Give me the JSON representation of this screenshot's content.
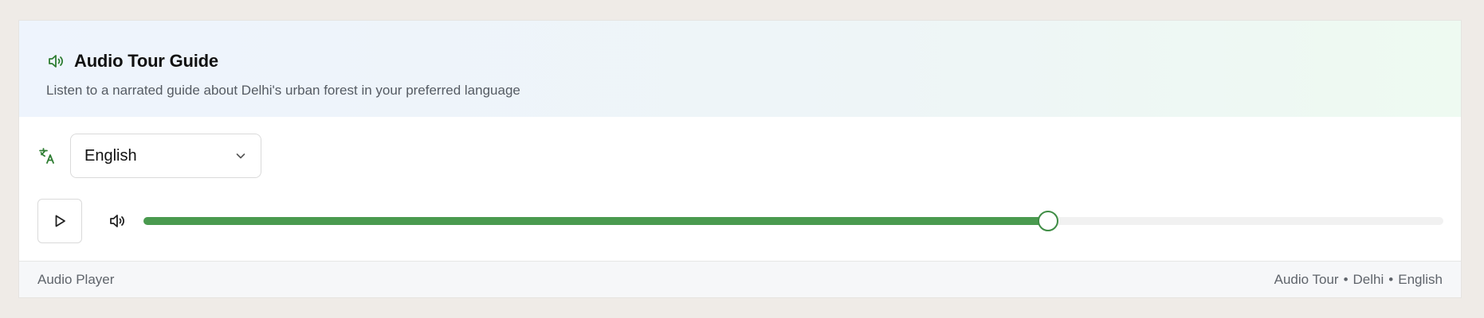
{
  "header": {
    "icon": "speaker-icon",
    "title": "Audio Tour Guide",
    "subtitle": "Listen to a narrated guide about Delhi's urban forest in your preferred language"
  },
  "language": {
    "icon": "translate-icon",
    "selected": "English"
  },
  "player": {
    "play_icon": "play-icon",
    "volume_icon": "volume-icon",
    "progress": 0.696,
    "accent": "#4a9a4f"
  },
  "footer": {
    "left": "Audio Player",
    "meta": [
      "Audio Tour",
      "Delhi",
      "English"
    ],
    "separator": "•"
  }
}
